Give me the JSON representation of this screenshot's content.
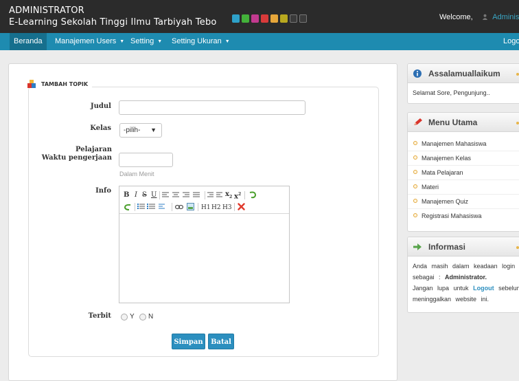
{
  "header": {
    "title": "ADMINISTRATOR",
    "subtitle": "E-Learning Sekolah Tinggi Ilmu Tarbiyah Tebo",
    "theme_swatches": [
      "#2ea1c9",
      "#43b13a",
      "#c23a8f",
      "#d83a3a",
      "#e6a63a",
      "#b8a81f",
      "#3a3a3a",
      "#3a3a3a"
    ],
    "welcome_label": "Welcome,",
    "user_name": "Administrator"
  },
  "nav": {
    "items": [
      {
        "label": "Beranda"
      },
      {
        "label": "Manajemen Users"
      },
      {
        "label": "Setting"
      },
      {
        "label": "Setting Ukuran"
      }
    ],
    "logout_label": "Logout"
  },
  "form": {
    "legend": "TAMBAH TOPIK",
    "judul_label": "Judul",
    "judul_value": "",
    "kelas_label": "Kelas",
    "kelas_value": "-pilih-",
    "pelajaran_label": "Pelajaran",
    "waktu_label": "Waktu pengerjaan",
    "waktu_value": "",
    "waktu_hint": "Dalam Menit",
    "info_label": "Info",
    "editor_headings": [
      "H1",
      "H2",
      "H3"
    ],
    "terbit_label": "Terbit",
    "radio_y": "Y",
    "radio_n": "N",
    "submit_label": "Simpan",
    "cancel_label": "Batal"
  },
  "sidebar": {
    "greeting_title": "Assalamuallaikum",
    "greeting_text": "Selamat Sore, Pengunjung..",
    "menu_title": "Menu Utama",
    "menu_items": [
      {
        "label": "Manajemen Mahasiswa"
      },
      {
        "label": "Manajemen Kelas"
      },
      {
        "label": "Mata Pelajaran"
      },
      {
        "label": "Materi"
      },
      {
        "label": "Manajemen Quiz"
      },
      {
        "label": "Registrasi Mahasiswa"
      }
    ],
    "info_title": "Informasi",
    "info_text_1": "Anda masih dalam keadaan login",
    "info_text_2": "sebagai :",
    "info_role": "Administrator.",
    "info_text_3": "Jangan lupa untuk",
    "info_logout": "Logout",
    "info_text_4": "sebelum",
    "info_text_5": "meninggalkan website ini."
  }
}
